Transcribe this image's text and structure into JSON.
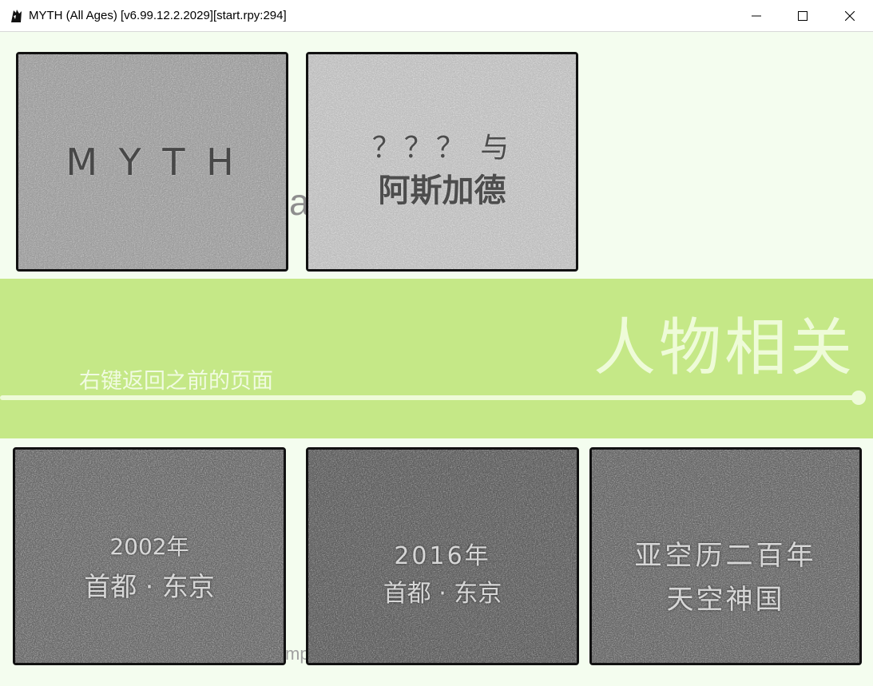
{
  "window": {
    "title": "MYTH (All Ages) [v6.99.12.2.2029][start.rpy:294]",
    "icon": "app-icon"
  },
  "colors": {
    "canvas_bg": "#f4fdef",
    "banner_bg": "#c5e887",
    "banner_text": "#eefbd8"
  },
  "background": {
    "ghost_a": "a",
    "ghost_b": "mp"
  },
  "banner": {
    "title": "人物相关",
    "hint": "右键返回之前的页面"
  },
  "cards": [
    {
      "lines": [
        "M Y T H"
      ]
    },
    {
      "lines": [
        "？？？ 与",
        "阿斯加德"
      ]
    },
    {
      "lines": [
        "2002年",
        "首都 · 东京"
      ]
    },
    {
      "lines": [
        "2016年",
        "首都 · 东京"
      ]
    },
    {
      "lines": [
        "亚空历二百年",
        "天空神国"
      ]
    }
  ]
}
